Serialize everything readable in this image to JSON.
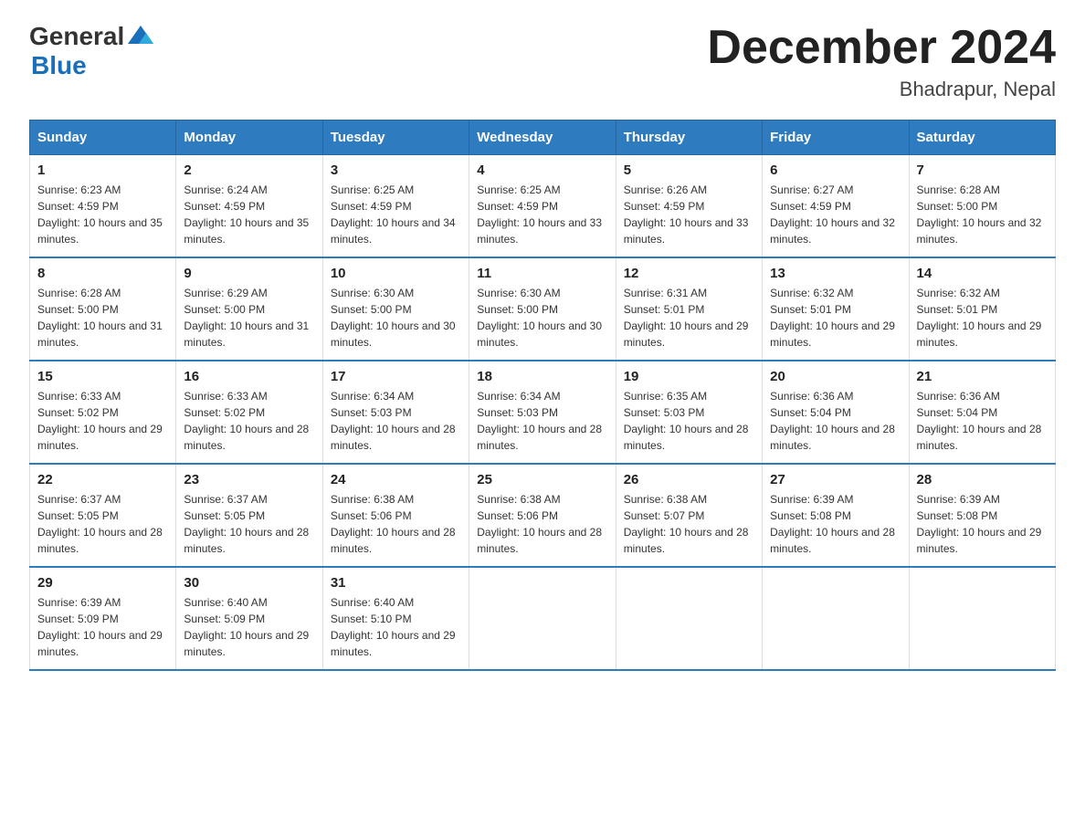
{
  "header": {
    "logo_general": "General",
    "logo_blue": "Blue",
    "month_title": "December 2024",
    "location": "Bhadrapur, Nepal"
  },
  "days_of_week": [
    "Sunday",
    "Monday",
    "Tuesday",
    "Wednesday",
    "Thursday",
    "Friday",
    "Saturday"
  ],
  "weeks": [
    [
      {
        "day": "1",
        "sunrise": "6:23 AM",
        "sunset": "4:59 PM",
        "daylight": "10 hours and 35 minutes."
      },
      {
        "day": "2",
        "sunrise": "6:24 AM",
        "sunset": "4:59 PM",
        "daylight": "10 hours and 35 minutes."
      },
      {
        "day": "3",
        "sunrise": "6:25 AM",
        "sunset": "4:59 PM",
        "daylight": "10 hours and 34 minutes."
      },
      {
        "day": "4",
        "sunrise": "6:25 AM",
        "sunset": "4:59 PM",
        "daylight": "10 hours and 33 minutes."
      },
      {
        "day": "5",
        "sunrise": "6:26 AM",
        "sunset": "4:59 PM",
        "daylight": "10 hours and 33 minutes."
      },
      {
        "day": "6",
        "sunrise": "6:27 AM",
        "sunset": "4:59 PM",
        "daylight": "10 hours and 32 minutes."
      },
      {
        "day": "7",
        "sunrise": "6:28 AM",
        "sunset": "5:00 PM",
        "daylight": "10 hours and 32 minutes."
      }
    ],
    [
      {
        "day": "8",
        "sunrise": "6:28 AM",
        "sunset": "5:00 PM",
        "daylight": "10 hours and 31 minutes."
      },
      {
        "day": "9",
        "sunrise": "6:29 AM",
        "sunset": "5:00 PM",
        "daylight": "10 hours and 31 minutes."
      },
      {
        "day": "10",
        "sunrise": "6:30 AM",
        "sunset": "5:00 PM",
        "daylight": "10 hours and 30 minutes."
      },
      {
        "day": "11",
        "sunrise": "6:30 AM",
        "sunset": "5:00 PM",
        "daylight": "10 hours and 30 minutes."
      },
      {
        "day": "12",
        "sunrise": "6:31 AM",
        "sunset": "5:01 PM",
        "daylight": "10 hours and 29 minutes."
      },
      {
        "day": "13",
        "sunrise": "6:32 AM",
        "sunset": "5:01 PM",
        "daylight": "10 hours and 29 minutes."
      },
      {
        "day": "14",
        "sunrise": "6:32 AM",
        "sunset": "5:01 PM",
        "daylight": "10 hours and 29 minutes."
      }
    ],
    [
      {
        "day": "15",
        "sunrise": "6:33 AM",
        "sunset": "5:02 PM",
        "daylight": "10 hours and 29 minutes."
      },
      {
        "day": "16",
        "sunrise": "6:33 AM",
        "sunset": "5:02 PM",
        "daylight": "10 hours and 28 minutes."
      },
      {
        "day": "17",
        "sunrise": "6:34 AM",
        "sunset": "5:03 PM",
        "daylight": "10 hours and 28 minutes."
      },
      {
        "day": "18",
        "sunrise": "6:34 AM",
        "sunset": "5:03 PM",
        "daylight": "10 hours and 28 minutes."
      },
      {
        "day": "19",
        "sunrise": "6:35 AM",
        "sunset": "5:03 PM",
        "daylight": "10 hours and 28 minutes."
      },
      {
        "day": "20",
        "sunrise": "6:36 AM",
        "sunset": "5:04 PM",
        "daylight": "10 hours and 28 minutes."
      },
      {
        "day": "21",
        "sunrise": "6:36 AM",
        "sunset": "5:04 PM",
        "daylight": "10 hours and 28 minutes."
      }
    ],
    [
      {
        "day": "22",
        "sunrise": "6:37 AM",
        "sunset": "5:05 PM",
        "daylight": "10 hours and 28 minutes."
      },
      {
        "day": "23",
        "sunrise": "6:37 AM",
        "sunset": "5:05 PM",
        "daylight": "10 hours and 28 minutes."
      },
      {
        "day": "24",
        "sunrise": "6:38 AM",
        "sunset": "5:06 PM",
        "daylight": "10 hours and 28 minutes."
      },
      {
        "day": "25",
        "sunrise": "6:38 AM",
        "sunset": "5:06 PM",
        "daylight": "10 hours and 28 minutes."
      },
      {
        "day": "26",
        "sunrise": "6:38 AM",
        "sunset": "5:07 PM",
        "daylight": "10 hours and 28 minutes."
      },
      {
        "day": "27",
        "sunrise": "6:39 AM",
        "sunset": "5:08 PM",
        "daylight": "10 hours and 28 minutes."
      },
      {
        "day": "28",
        "sunrise": "6:39 AM",
        "sunset": "5:08 PM",
        "daylight": "10 hours and 29 minutes."
      }
    ],
    [
      {
        "day": "29",
        "sunrise": "6:39 AM",
        "sunset": "5:09 PM",
        "daylight": "10 hours and 29 minutes."
      },
      {
        "day": "30",
        "sunrise": "6:40 AM",
        "sunset": "5:09 PM",
        "daylight": "10 hours and 29 minutes."
      },
      {
        "day": "31",
        "sunrise": "6:40 AM",
        "sunset": "5:10 PM",
        "daylight": "10 hours and 29 minutes."
      },
      null,
      null,
      null,
      null
    ]
  ]
}
